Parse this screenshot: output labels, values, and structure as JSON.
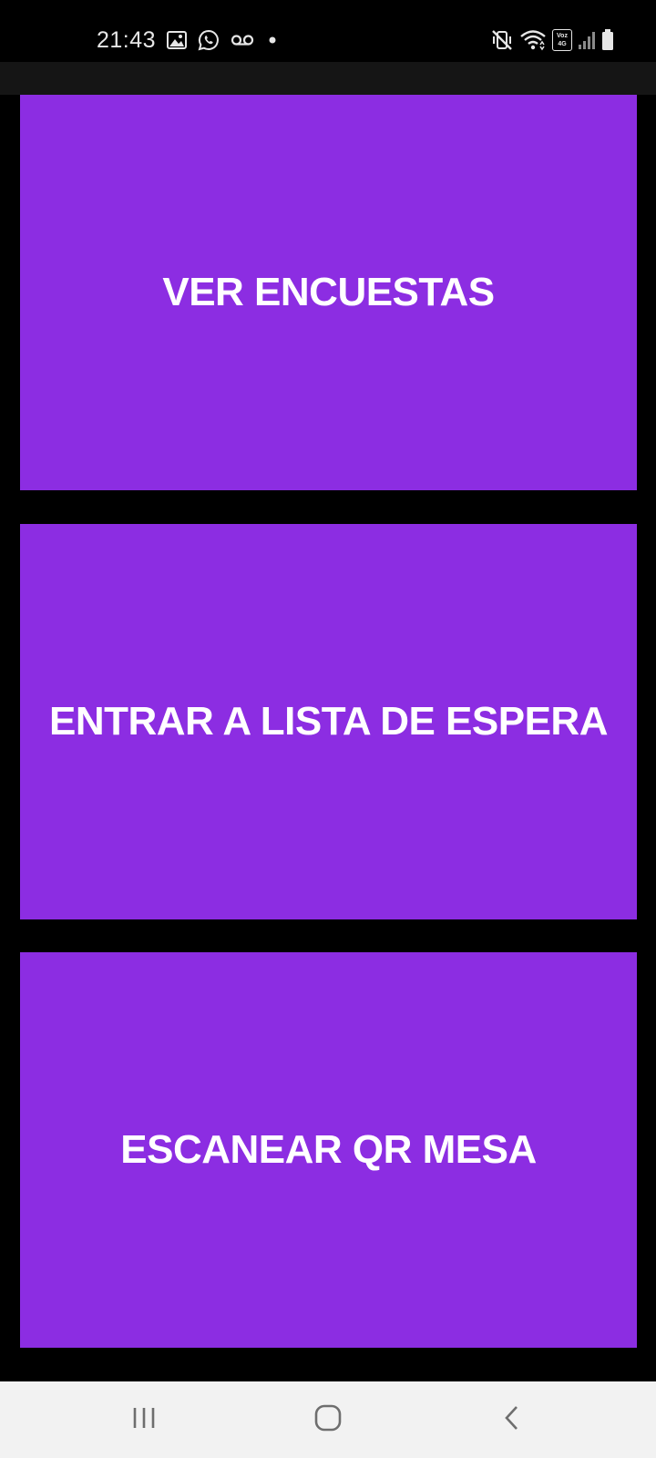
{
  "status_bar": {
    "time": "21:43",
    "left_icons": [
      "image-icon",
      "whatsapp-icon",
      "voicemail-icon",
      "dot-icon"
    ],
    "right_icons": [
      "mute-vibrate-icon",
      "wifi-icon",
      "volte-4g-icon",
      "signal-icon",
      "battery-icon"
    ],
    "volte_label_top": "Voz",
    "volte_label_bottom": "4G"
  },
  "buttons": [
    {
      "label": "VER ENCUESTAS"
    },
    {
      "label": "ENTRAR A LISTA DE ESPERA"
    },
    {
      "label": "ESCANEAR QR MESA"
    }
  ],
  "nav_bar": {
    "items": [
      "recents-icon",
      "home-icon",
      "back-icon"
    ]
  },
  "colors": {
    "background": "#000000",
    "button": "#8c2de2",
    "button_text": "#ffffff",
    "app_bar": "#151515",
    "nav_bar": "#f2f2f2"
  }
}
